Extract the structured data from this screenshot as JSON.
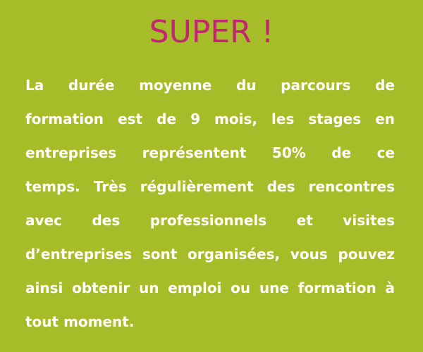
{
  "colors": {
    "background": "#a7bc29",
    "title": "#c2266f",
    "text": "#ffffff"
  },
  "heading": {
    "title": "SUPER !"
  },
  "content": {
    "lines": [
      "La durée moyenne du parcours de",
      "formation est de 9 mois, les stages en",
      "entreprises représentent 50% de ce",
      "temps. Très régulièrement des rencontres",
      "avec des professionnels et visites",
      "d’entreprises sont organisées, vous pouvez",
      "ainsi obtenir un emploi ou une formation à",
      "tout moment."
    ]
  }
}
